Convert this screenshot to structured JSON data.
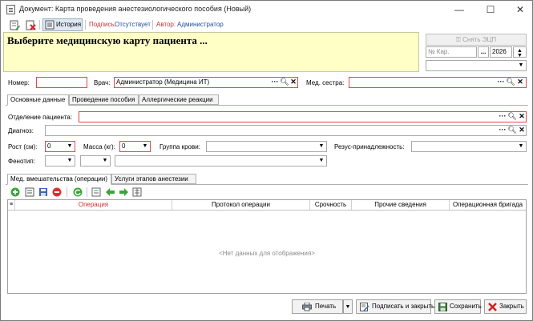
{
  "window": {
    "title": "Документ: Карта проведения анестезиологического пособия (Новый)",
    "minimize": "—",
    "maximize": "☐",
    "close": "✕"
  },
  "toolbar": {
    "history_label": "История",
    "signature_label": "Подпись:",
    "signature_value": "Отсутствует",
    "author_label": "Автор:",
    "author_value": "Администратор"
  },
  "banner": {
    "text": "Выберите медицинскую карту пациента ..."
  },
  "right_panel": {
    "remove_eds_label": "Снять ЭЦП",
    "card_placeholder": "№ Кар.",
    "year": "2026",
    "card_search_btn": "..."
  },
  "header_fields": {
    "number_label": "Номер:",
    "number_value": "",
    "doctor_label": "Врач:",
    "doctor_value": "Администратор (Медицина ИТ)",
    "nurse_label": "Мед. сестра:",
    "nurse_value": ""
  },
  "main_tabs": [
    {
      "label": "Основные данные",
      "active": true
    },
    {
      "label": "Проведение пособия",
      "active": false
    },
    {
      "label": "Аллергические реакции",
      "active": false
    }
  ],
  "form": {
    "department_label": "Отделение пациента:",
    "department_value": "",
    "diagnosis_label": "Диагноз:",
    "diagnosis_value": "",
    "height_label": "Рост (см):",
    "height_value": "0",
    "weight_label": "Масса (кг):",
    "weight_value": "0",
    "blood_group_label": "Группа крови:",
    "blood_group_value": "",
    "rh_label": "Резус-принадлежность:",
    "rh_value": "",
    "phenotype_label": "Фенотип:",
    "phenotype_values": [
      "",
      "",
      ""
    ]
  },
  "sub_tabs": [
    {
      "label": "Мед. вмешательства (операции)",
      "active": true
    },
    {
      "label": "Услуги этапов анестезии",
      "active": false
    }
  ],
  "grid": {
    "columns": [
      "Операция",
      "Протокол операции",
      "Срочность",
      "Прочие сведения",
      "Операционная бригада"
    ],
    "rows": [],
    "empty_text": "<Нет данных для отображения>"
  },
  "footer": {
    "print_label": "Печать",
    "sign_close_label": "Подписать и закрыть",
    "save_label": "Сохранить",
    "close_label": "Закрыть"
  },
  "colors": {
    "required_border": "#e0484a",
    "banner_bg": "#ffffc6",
    "signature_value": "#1f4fa0",
    "grid_operation_header": "#d03030"
  }
}
